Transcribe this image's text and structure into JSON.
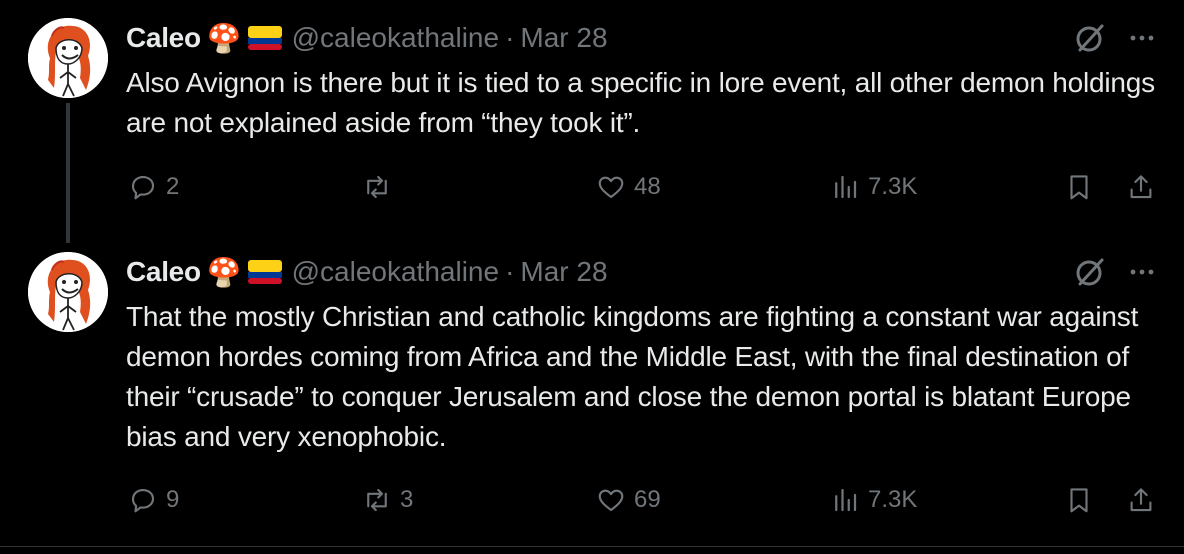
{
  "tweets": [
    {
      "author": {
        "name": "Caleo",
        "emojis": "🍄",
        "handle": "@caleokathaline",
        "separator": "·",
        "date": "Mar 28"
      },
      "text": "Also Avignon is there but it is tied to a specific in lore event, all other demon holdings are not explained aside from “they took it”.",
      "actions": {
        "replies": "2",
        "reposts": "",
        "likes": "48",
        "views": "7.3K"
      }
    },
    {
      "author": {
        "name": "Caleo",
        "emojis": "🍄",
        "handle": "@caleokathaline",
        "separator": "·",
        "date": "Mar 28"
      },
      "text": "That the mostly Christian and catholic kingdoms are fighting a constant war against demon hordes coming from Africa and the Middle East, with the final destination of their “crusade” to conquer Jerusalem and close the demon portal is blatant Europe bias and very xenophobic.",
      "actions": {
        "replies": "9",
        "reposts": "3",
        "likes": "69",
        "views": "7.3K"
      }
    }
  ],
  "colors": {
    "background": "#000000",
    "text": "#e7e9ea",
    "muted": "#71767b",
    "thread_line": "#333639"
  },
  "icons": [
    "avatar-illustration",
    "mushroom-emoji",
    "colombia-flag-emoji",
    "grok-icon",
    "more-icon",
    "reply-icon",
    "repost-icon",
    "like-icon",
    "views-icon",
    "bookmark-icon",
    "share-icon"
  ]
}
